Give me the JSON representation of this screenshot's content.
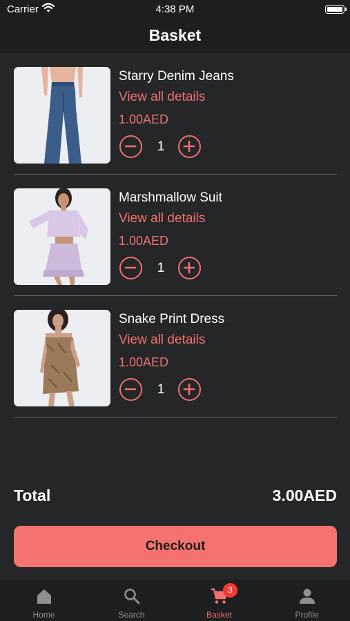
{
  "status_bar": {
    "carrier": "Carrier",
    "time": "4:38 PM"
  },
  "header": {
    "title": "Basket"
  },
  "basket": {
    "items": [
      {
        "name": "Starry Denim Jeans",
        "details_link": "View all details",
        "price": "1.00AED",
        "quantity": "1",
        "image": "jeans-photo"
      },
      {
        "name": "Marshmallow Suit",
        "details_link": "View all details",
        "price": "1.00AED",
        "quantity": "1",
        "image": "lilac-suit-photo"
      },
      {
        "name": "Snake Print Dress",
        "details_link": "View all details",
        "price": "1.00AED",
        "quantity": "1",
        "image": "snake-print-dress-photo"
      }
    ]
  },
  "summary": {
    "total_label": "Total",
    "total_value": "3.00AED",
    "checkout_label": "Checkout"
  },
  "tabbar": {
    "tabs": [
      {
        "label": "Home",
        "icon": "home-icon",
        "active": false
      },
      {
        "label": "Search",
        "icon": "search-icon",
        "active": false
      },
      {
        "label": "Basket",
        "icon": "cart-icon",
        "active": true,
        "badge": "3"
      },
      {
        "label": "Profile",
        "icon": "person-icon",
        "active": false
      }
    ]
  },
  "colors": {
    "accent": "#f0706e",
    "button": "#f47370",
    "background": "#252628",
    "bar": "#1d1e20",
    "badge": "#f23b33",
    "inactive_tab": "#8e8f93"
  }
}
